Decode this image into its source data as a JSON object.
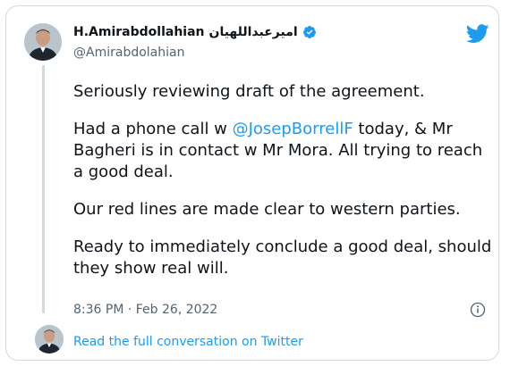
{
  "author": {
    "display_name": "H.Amirabdollahian",
    "display_name_fa": "امیرعبداللهیان",
    "handle": "@Amirabdolahian"
  },
  "tweet": {
    "paragraph1": "Seriously reviewing draft of the agreement.",
    "paragraph2_before": "Had a phone call w ",
    "mention": "@JosepBorrellF",
    "paragraph2_after": " today, & Mr Bagheri is in contact w Mr Mora. All trying to reach a good deal.",
    "paragraph3": "Our red lines are made clear to western parties.",
    "paragraph4": "Ready to immediately conclude a good deal, should they show real will."
  },
  "timestamp": "8:36 PM · Feb 26, 2022",
  "read_more_label": "Read the full conversation on Twitter",
  "icons": {
    "verified": "verified-badge-icon",
    "twitter": "twitter-bird-icon",
    "info": "info-icon"
  },
  "colors": {
    "accent": "#1d9bf0",
    "text": "#0f1419",
    "muted": "#536471",
    "border": "#cfd9de"
  }
}
